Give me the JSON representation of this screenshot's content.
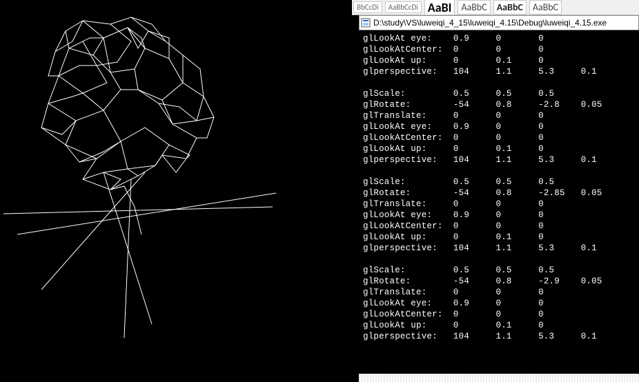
{
  "ribbon": {
    "styles": [
      "BbCcDi",
      "AaBbCcDi",
      "AaBI",
      "AaBbC",
      "AaBbC",
      "AaBbC"
    ]
  },
  "console": {
    "title_path": "D:\\study\\VS\\luweiqi_4_15\\luweiqi_4.15\\Debug\\luweiqi_4.15.exe",
    "icon": "app-icon",
    "blocks": [
      {
        "rows": [
          {
            "label": "glLookAt eye:",
            "v": [
              "0.9",
              "0",
              "0",
              ""
            ]
          },
          {
            "label": "glLookAtCenter:",
            "v": [
              "0",
              "0",
              "0",
              ""
            ]
          },
          {
            "label": "glLookAt up:",
            "v": [
              "0",
              "0.1",
              "0",
              ""
            ]
          },
          {
            "label": "glperspective:",
            "v": [
              "104",
              "1.1",
              "5.3",
              "0.1"
            ]
          }
        ]
      },
      {
        "rows": [
          {
            "label": "glScale:",
            "v": [
              "0.5",
              "0.5",
              "0.5",
              ""
            ]
          },
          {
            "label": "glRotate:",
            "v": [
              "-54",
              "0.8",
              "-2.8",
              "0.05"
            ]
          },
          {
            "label": "glTranslate:",
            "v": [
              "0",
              "0",
              "0",
              ""
            ]
          },
          {
            "label": "glLookAt eye:",
            "v": [
              "0.9",
              "0",
              "0",
              ""
            ]
          },
          {
            "label": "glLookAtCenter:",
            "v": [
              "0",
              "0",
              "0",
              ""
            ]
          },
          {
            "label": "glLookAt up:",
            "v": [
              "0",
              "0.1",
              "0",
              ""
            ]
          },
          {
            "label": "glperspective:",
            "v": [
              "104",
              "1.1",
              "5.3",
              "0.1"
            ]
          }
        ]
      },
      {
        "rows": [
          {
            "label": "glScale:",
            "v": [
              "0.5",
              "0.5",
              "0.5",
              ""
            ]
          },
          {
            "label": "glRotate:",
            "v": [
              "-54",
              "0.8",
              "-2.85",
              "0.05"
            ]
          },
          {
            "label": "glTranslate:",
            "v": [
              "0",
              "0",
              "0",
              ""
            ]
          },
          {
            "label": "glLookAt eye:",
            "v": [
              "0.9",
              "0",
              "0",
              ""
            ]
          },
          {
            "label": "glLookAtCenter:",
            "v": [
              "0",
              "0",
              "0",
              ""
            ]
          },
          {
            "label": "glLookAt up:",
            "v": [
              "0",
              "0.1",
              "0",
              ""
            ]
          },
          {
            "label": "glperspective:",
            "v": [
              "104",
              "1.1",
              "5.3",
              "0.1"
            ]
          }
        ]
      },
      {
        "rows": [
          {
            "label": "glScale:",
            "v": [
              "0.5",
              "0.5",
              "0.5",
              ""
            ]
          },
          {
            "label": "glRotate:",
            "v": [
              "-54",
              "0.8",
              "-2.9",
              "0.05"
            ]
          },
          {
            "label": "glTranslate:",
            "v": [
              "0",
              "0",
              "0",
              ""
            ]
          },
          {
            "label": "glLookAt eye:",
            "v": [
              "0.9",
              "0",
              "0",
              ""
            ]
          },
          {
            "label": "glLookAtCenter:",
            "v": [
              "0",
              "0",
              "0",
              ""
            ]
          },
          {
            "label": "glLookAt up:",
            "v": [
              "0",
              "0.1",
              "0",
              ""
            ]
          },
          {
            "label": "glperspective:",
            "v": [
              "104",
              "1.1",
              "5.3",
              "0.1"
            ]
          }
        ]
      }
    ]
  },
  "colors": {
    "bg": "#000000",
    "fg": "#ffffff"
  }
}
